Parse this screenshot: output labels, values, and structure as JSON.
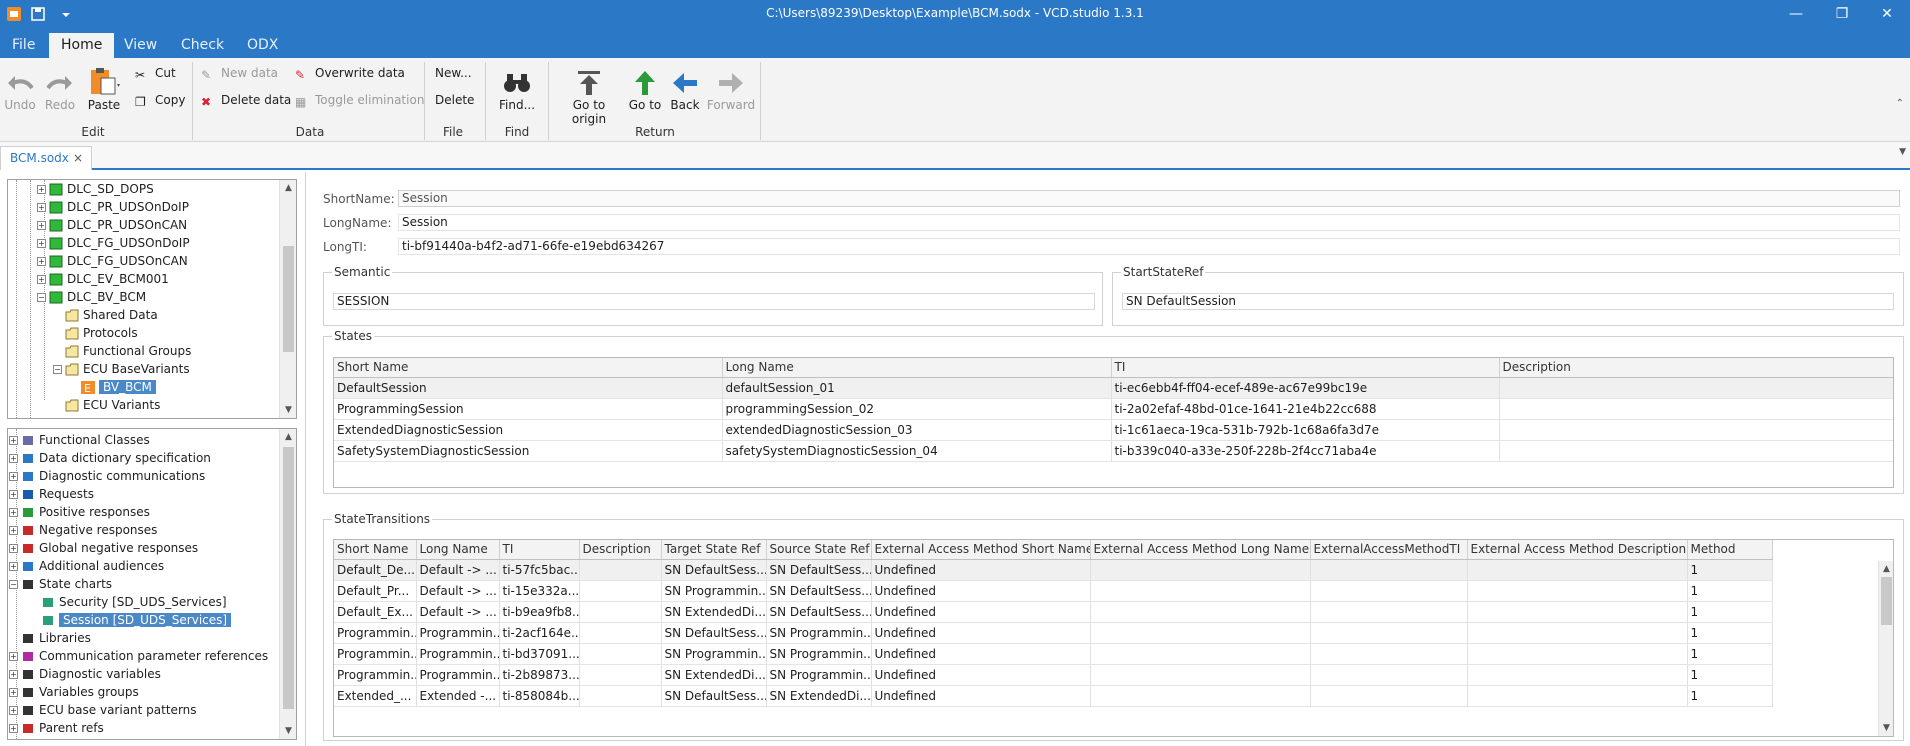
{
  "window": {
    "title": "C:\\Users\\89239\\Desktop\\Example\\BCM.sodx - VCD.studio 1.3.1",
    "minimize": "—",
    "restore": "❐",
    "close": "✕"
  },
  "menu": {
    "tabs": [
      "File",
      "Home",
      "View",
      "Check",
      "ODX"
    ]
  },
  "ribbon": {
    "edit": {
      "undo": "Undo",
      "redo": "Redo",
      "paste": "Paste",
      "cut": "Cut",
      "copy": "Copy",
      "group": "Edit"
    },
    "data": {
      "new_data": "New data",
      "overwrite_data": "Overwrite data",
      "delete_data": "Delete data",
      "toggle_elimination": "Toggle elimination",
      "group": "Data"
    },
    "file": {
      "new": "New...",
      "delete": "Delete",
      "group": "File"
    },
    "find": {
      "find": "Find...",
      "group": "Find"
    },
    "return": {
      "go_to_origin": "Go to origin",
      "go_to": "Go to",
      "back": "Back",
      "forward": "Forward",
      "group": "Return"
    }
  },
  "doc_tab": {
    "label": "BCM.sodx",
    "close": "×"
  },
  "upper_tree": [
    {
      "label": "DLC_SD_DOPS",
      "icon": "green-node"
    },
    {
      "label": "DLC_PR_UDSOnDoIP",
      "icon": "green-node"
    },
    {
      "label": "DLC_PR_UDSOnCAN",
      "icon": "green-node"
    },
    {
      "label": "DLC_FG_UDSOnDoIP",
      "icon": "green-node"
    },
    {
      "label": "DLC_FG_UDSOnCAN",
      "icon": "green-node"
    },
    {
      "label": "DLC_EV_BCM001",
      "icon": "green-node"
    },
    {
      "label": "DLC_BV_BCM",
      "icon": "green-node"
    },
    {
      "label": "Shared Data",
      "icon": "folder"
    },
    {
      "label": "Protocols",
      "icon": "folder"
    },
    {
      "label": "Functional Groups",
      "icon": "folder"
    },
    {
      "label": "ECU BaseVariants",
      "icon": "folder-open"
    },
    {
      "label": "BV_BCM",
      "icon": "e-badge"
    },
    {
      "label": "ECU Variants",
      "icon": "folder"
    }
  ],
  "lower_tree": [
    {
      "label": "Functional Classes"
    },
    {
      "label": "Data dictionary specification"
    },
    {
      "label": "Diagnostic communications"
    },
    {
      "label": "Requests"
    },
    {
      "label": "Positive responses"
    },
    {
      "label": "Negative responses"
    },
    {
      "label": "Global negative responses"
    },
    {
      "label": "Additional audiences"
    },
    {
      "label": "State charts"
    },
    {
      "label": "Security [SD_UDS_Services]"
    },
    {
      "label": "Session [SD_UDS_Services]"
    },
    {
      "label": "Libraries"
    },
    {
      "label": "Communication parameter references"
    },
    {
      "label": "Diagnostic variables"
    },
    {
      "label": "Variables groups"
    },
    {
      "label": "ECU base variant patterns"
    },
    {
      "label": "Parent refs"
    }
  ],
  "form": {
    "short_name_label": "ShortName:",
    "short_name": "Session",
    "long_name_label": "LongName:",
    "long_name": "Session",
    "long_ti_label": "LongTI:",
    "long_ti": "ti-bf91440a-b4f2-ad71-66fe-e19ebd634267",
    "semantic_title": "Semantic",
    "semantic": "SESSION",
    "start_state_title": "StartStateRef",
    "start_state": "SN  DefaultSession"
  },
  "states": {
    "title": "States",
    "headers": [
      "Short Name",
      "Long Name",
      "TI",
      "Description"
    ],
    "rows": [
      [
        "DefaultSession",
        "defaultSession_01",
        "ti-ec6ebb4f-ff04-ecef-489e-ac67e99bc19e",
        ""
      ],
      [
        "ProgrammingSession",
        "programmingSession_02",
        "ti-2a02efaf-48bd-01ce-1641-21e4b22cc688",
        ""
      ],
      [
        "ExtendedDiagnosticSession",
        "extendedDiagnosticSession_03",
        "ti-1c61aeca-19ca-531b-792b-1c68a6fa3d7e",
        ""
      ],
      [
        "SafetySystemDiagnosticSession",
        "safetySystemDiagnosticSession_04",
        "ti-b339c040-a33e-250f-228b-2f4cc71aba4e",
        ""
      ]
    ]
  },
  "transitions": {
    "title": "StateTransitions",
    "headers": [
      "Short Name",
      "Long Name",
      "TI",
      "Description",
      "Target State Ref",
      "Source State Ref",
      "External Access Method Short Name",
      "External Access Method Long Name",
      "ExternalAccessMethodTI",
      "External Access Method Description",
      "Method"
    ],
    "rows": [
      [
        "Default_De...",
        "Default -> ...",
        "ti-57fc5bac...",
        "",
        "SN  DefaultSess...",
        "SN  DefaultSess...",
        "Undefined",
        "",
        "",
        "",
        "1"
      ],
      [
        "Default_Pr...",
        "Default -> ...",
        "ti-15e332a...",
        "",
        "SN  Programmin...",
        "SN  DefaultSess...",
        "Undefined",
        "",
        "",
        "",
        "1"
      ],
      [
        "Default_Ex...",
        "Default -> ...",
        "ti-b9ea9fb8...",
        "",
        "SN  ExtendedDi...",
        "SN  DefaultSess...",
        "Undefined",
        "",
        "",
        "",
        "1"
      ],
      [
        "Programmin...",
        "Programmin...",
        "ti-2acf164e...",
        "",
        "SN  DefaultSess...",
        "SN  Programmin...",
        "Undefined",
        "",
        "",
        "",
        "1"
      ],
      [
        "Programmin...",
        "Programmin...",
        "ti-bd37091...",
        "",
        "SN  Programmin...",
        "SN  Programmin...",
        "Undefined",
        "",
        "",
        "",
        "1"
      ],
      [
        "Programmin...",
        "Programmin...",
        "ti-2b89873...",
        "",
        "SN  ExtendedDi...",
        "SN  Programmin...",
        "Undefined",
        "",
        "",
        "",
        "1"
      ],
      [
        "Extended_...",
        "Extended -...",
        "ti-858084b...",
        "",
        "SN  DefaultSess...",
        "SN  ExtendedDi...",
        "Undefined",
        "",
        "",
        "",
        "1"
      ]
    ]
  },
  "colors": {
    "accent": "#2b78c7",
    "selection": "#4a88c7"
  }
}
